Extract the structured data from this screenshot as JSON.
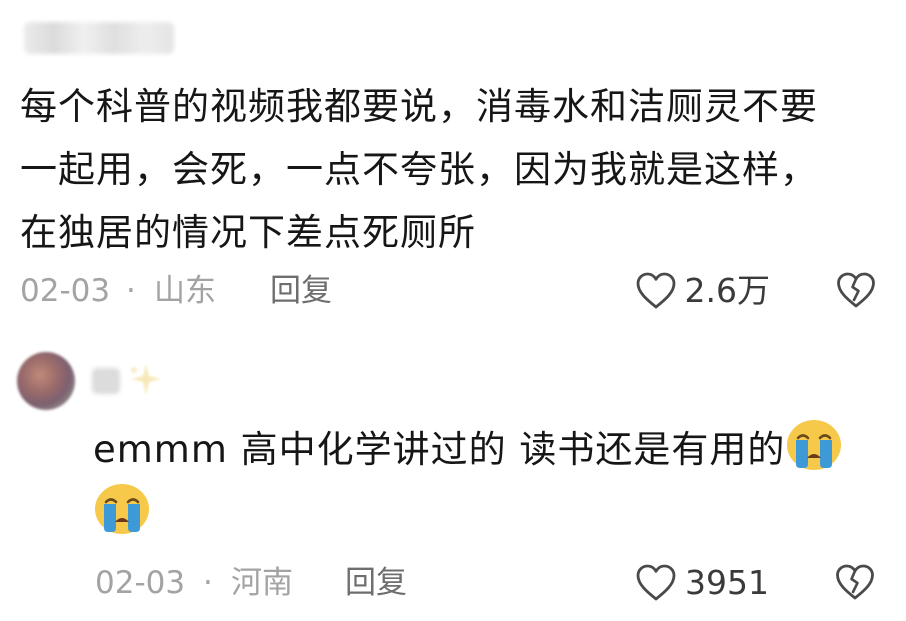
{
  "main_comment": {
    "text": "每个科普的视频我都要说，消毒水和洁厕灵不要\n一起用，会死，一点不夸张，因为我就是这样，\n在独居的情况下差点死厕所",
    "date": "02-03",
    "separator": "·",
    "location": "山东",
    "reply_label": "回复",
    "like_count": "2.6万"
  },
  "reply_comment": {
    "text": "emmm 高中化学讲过的 读书还是有用的",
    "emoji": "crying-face",
    "date": "02-03",
    "separator": "·",
    "location": "河南",
    "reply_label": "回复",
    "like_count": "3951"
  },
  "colors": {
    "meta_gray": "#a3a3a3",
    "reply_gray": "#6e6e6e",
    "text": "#161616",
    "emoji_yellow": "#f7c94a",
    "tear_blue": "#3d9ad6"
  }
}
